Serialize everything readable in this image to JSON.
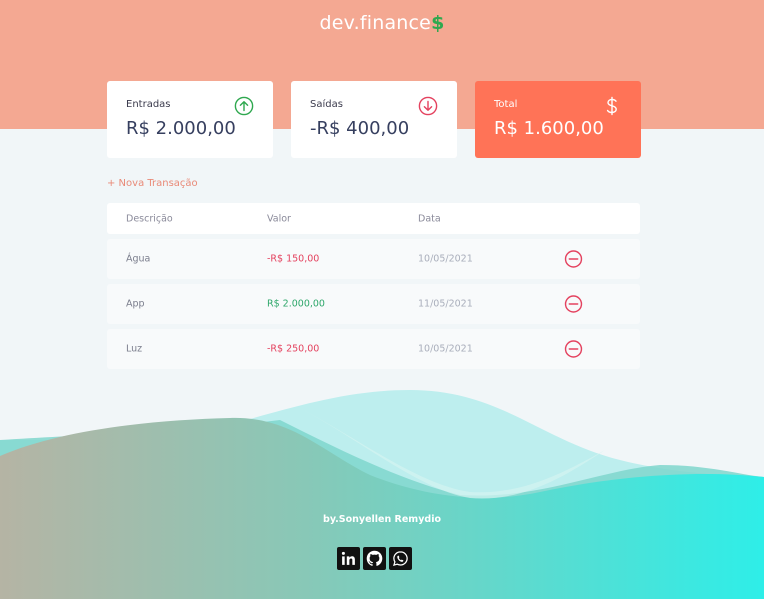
{
  "header": {
    "title": "dev.finance",
    "title_symbol": "$"
  },
  "colors": {
    "header_bg": "#f4a892",
    "income_green": "#2fa84f",
    "expense_red": "#e4425f",
    "total_card_bg": "#ff7357",
    "wave_teal": "#36ede7"
  },
  "summary": {
    "income": {
      "label": "Entradas",
      "value": "R$ 2.000,00",
      "icon": "arrow-up-circle-icon"
    },
    "expense": {
      "label": "Saídas",
      "value": "-R$ 400,00",
      "icon": "arrow-down-circle-icon"
    },
    "total": {
      "label": "Total",
      "value": "R$ 1.600,00",
      "icon": "dollar-sign-icon"
    }
  },
  "new_transaction_label": "+ Nova Transação",
  "transactions": {
    "headers": [
      "Descrição",
      "Valor",
      "Data"
    ],
    "rows": [
      {
        "description": "Água",
        "amount": "-R$ 150,00",
        "date": "10/05/2021",
        "type": "expense"
      },
      {
        "description": "App",
        "amount": "R$ 2.000,00",
        "date": "11/05/2021",
        "type": "income"
      },
      {
        "description": "Luz",
        "amount": "-R$ 250,00",
        "date": "10/05/2021",
        "type": "expense"
      }
    ],
    "remove_icon": "minus-circle-icon"
  },
  "footer": {
    "credit": "by.Sonyellen Remydio",
    "social_icons": [
      "linkedin-icon",
      "github-icon",
      "whatsapp-icon"
    ]
  }
}
